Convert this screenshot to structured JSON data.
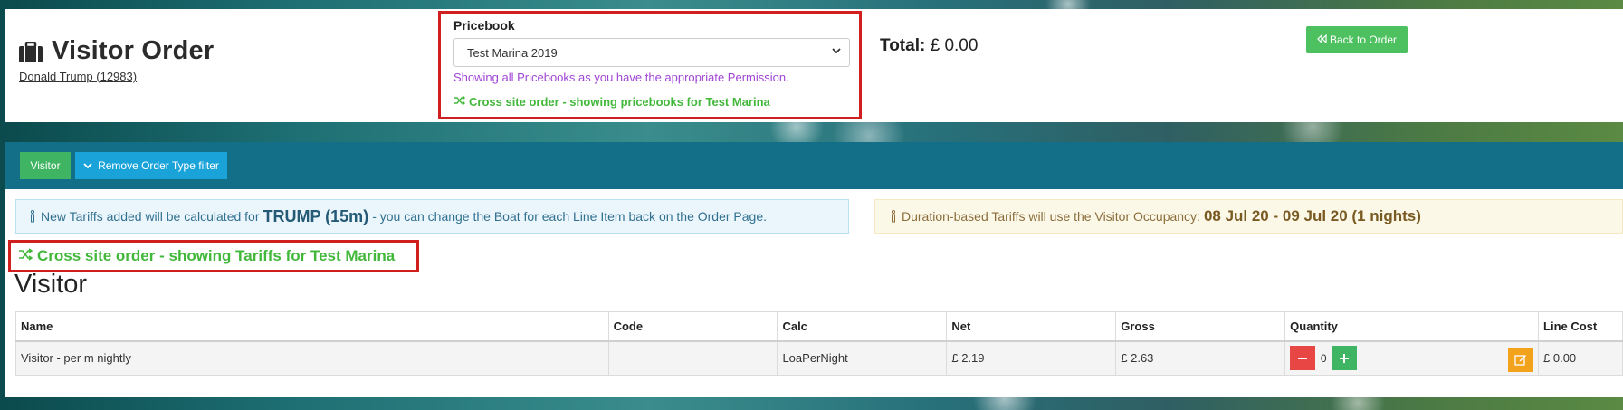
{
  "header": {
    "title": "Visitor Order",
    "visitor_link": "Donald Trump (12983)",
    "total_label": "Total:",
    "total_value": "£ 0.00",
    "back_button": "Back to Order"
  },
  "pricebook": {
    "label": "Pricebook",
    "selected": "Test Marina 2019",
    "permission_note": "Showing all Pricebooks as you have the appropriate Permission.",
    "cross_site_note": "Cross site order - showing pricebooks for Test Marina"
  },
  "toolbar": {
    "visitor_button": "Visitor",
    "remove_filter_button": "Remove Order Type filter"
  },
  "alerts": {
    "info_prefix": "New Tariffs added will be calculated for",
    "info_boat": "TRUMP (15m)",
    "info_suffix": "- you can change the Boat for each Line Item back on the Order Page.",
    "warning_prefix": "Duration-based Tariffs will use the Visitor Occupancy:",
    "warning_dates": "08 Jul 20 - 09 Jul 20 (1 nights)"
  },
  "cross_site_tariffs": "Cross site order - showing Tariffs for Test Marina",
  "section_title": "Visitor",
  "table": {
    "headers": [
      "Name",
      "Code",
      "Calc",
      "Net",
      "Gross",
      "Quantity",
      "Line Cost"
    ],
    "rows": [
      {
        "name": "Visitor - per m nightly",
        "code": "",
        "calc": "LoaPerNight",
        "net": "£ 2.19",
        "gross": "£ 2.63",
        "quantity": "0",
        "line_cost": "£ 0.00"
      }
    ]
  },
  "colors": {
    "success": "#3fb462",
    "info": "#1aa3d9",
    "danger": "#e84545",
    "warning": "#f3a21b",
    "highlight_border": "#d11f1f",
    "toolbar": "#136f87"
  }
}
